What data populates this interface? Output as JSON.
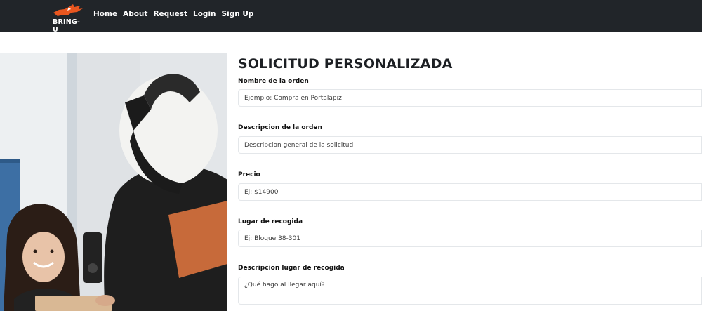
{
  "brand": {
    "name": "BRING-U",
    "accent": "#e8561f"
  },
  "nav": {
    "links": [
      {
        "label": "Home"
      },
      {
        "label": "About"
      },
      {
        "label": "Request"
      },
      {
        "label": "Login"
      },
      {
        "label": "Sign Up"
      }
    ]
  },
  "form": {
    "title": "SOLICITUD PERSONALIZADA",
    "fields": [
      {
        "label": "Nombre de la orden",
        "placeholder": "Ejemplo: Compra en Portalapiz",
        "value": ""
      },
      {
        "label": "Descripcion de la orden",
        "placeholder": "Descripcion general de la solicitud",
        "value": ""
      },
      {
        "label": "Precio",
        "placeholder": "Ej: $14900",
        "value": ""
      },
      {
        "label": "Lugar de recogida",
        "placeholder": "Ej: Bloque 38-301",
        "value": ""
      },
      {
        "label": "Descripcion lugar de recogida",
        "placeholder": "¿Qué hago al llegar aquí?",
        "value": ""
      }
    ]
  },
  "colors": {
    "navbar": "#212529",
    "text": "#212529",
    "border": "#e4e7ea"
  }
}
